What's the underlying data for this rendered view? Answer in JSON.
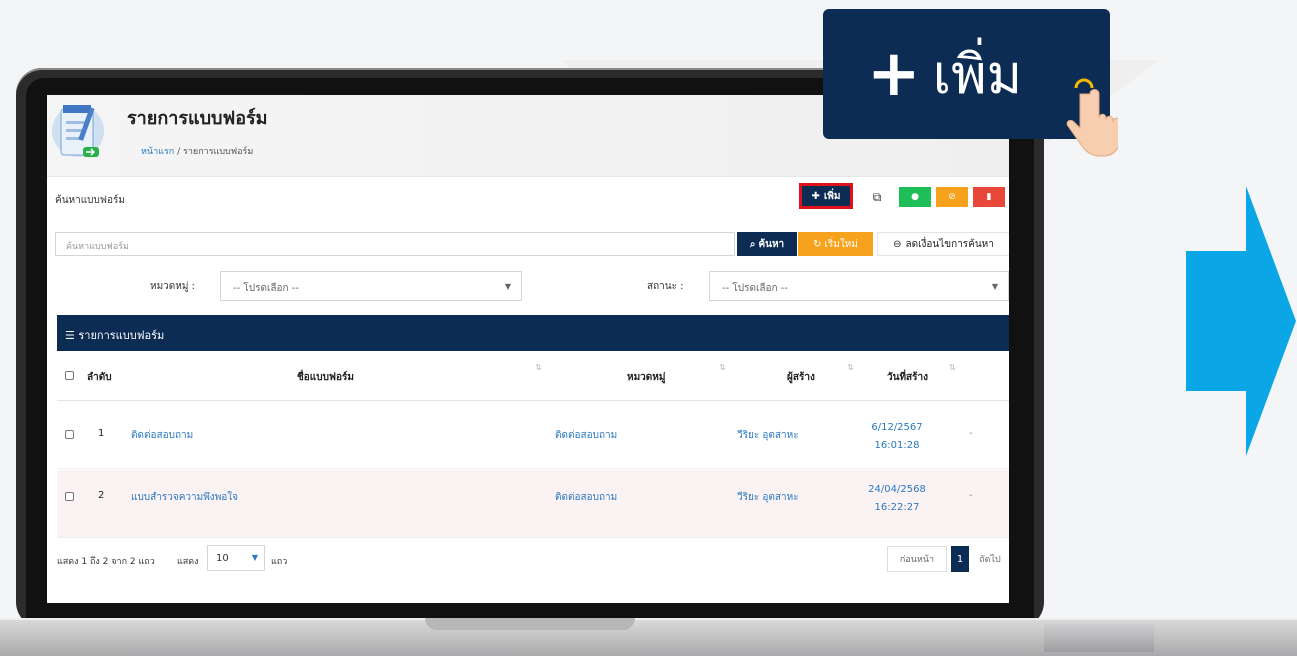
{
  "page": {
    "title": "รายการแบบฟอร์ม",
    "breadcrumb_home": "หน้าแรก",
    "breadcrumb_sep": "/",
    "breadcrumb_current": "รายการแบบฟอร์ม"
  },
  "toolbar": {
    "search_title": "ค้นหาแบบฟอร์ม",
    "add_label": "เพิ่ม",
    "copy_icon": "copy-icon",
    "view_icon": "eye-icon",
    "hide_icon": "eye-slash-icon",
    "delete_icon": "trash-icon"
  },
  "search": {
    "placeholder": "ค้นหาแบบฟอร์ม",
    "search_label": "ค้นหา",
    "reset_label": "เริ่มใหม่",
    "less_label": "ลดเงื่อนไขการค้นหา"
  },
  "filters": {
    "category_label": "หมวดหมู่ :",
    "category_value": "-- โปรดเลือก --",
    "status_label": "สถานะ :",
    "status_value": "-- โปรดเลือก --"
  },
  "list": {
    "header": "รายการแบบฟอร์ม",
    "columns": [
      "ลำดับ",
      "ชื่อแบบฟอร์ม",
      "หมวดหมู่",
      "ผู้สร้าง",
      "วันที่สร้าง"
    ],
    "rows": [
      {
        "no": "1",
        "name": "ติดต่อสอบถาม",
        "category": "ติดต่อสอบถาม",
        "creator": "วีริยะ อุตสาหะ",
        "date": "6/12/2567",
        "time": "16:01:28",
        "extra": "-"
      },
      {
        "no": "2",
        "name": "แบบสำรวจความพึงพอใจ",
        "category": "ติดต่อสอบถาม",
        "creator": "วีริยะ อุตสาหะ",
        "date": "24/04/2568",
        "time": "16:22:27",
        "extra": "-"
      }
    ]
  },
  "footer": {
    "info": "แสดง 1 ถึง 2 จาก 2 แถว",
    "show_label": "แสดง",
    "page_size": "10",
    "rows_label": "แถว",
    "prev_label": "ก่อนหน้า",
    "current_page": "1",
    "next_label": "ถัดไป"
  },
  "callout": {
    "plus": "+",
    "label": "เพิ่ม"
  },
  "colors": {
    "navy": "#0d2c54",
    "orange": "#f7a21c",
    "green": "#1fbf58",
    "red": "#e7483a",
    "arrow": "#0aa6e6",
    "highlight": "#e1101a"
  }
}
